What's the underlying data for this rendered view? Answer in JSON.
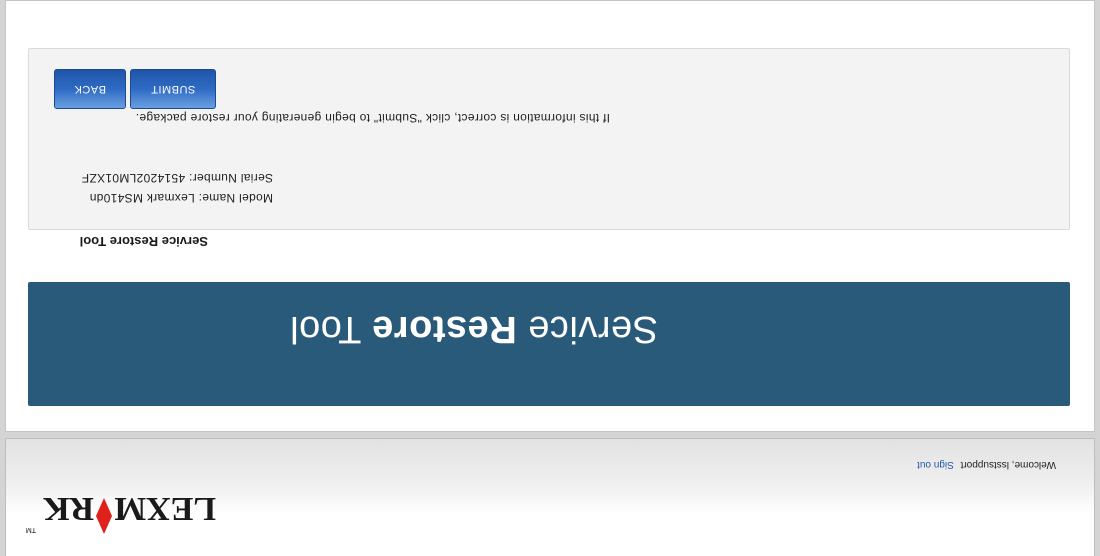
{
  "header": {
    "logo_text": "LEXMARK",
    "welcome_text": "Welcome, lsstsupport",
    "sign_out_label": "Sign out"
  },
  "banner": {
    "title_light_1": "Service",
    "title_bold": "Restore",
    "title_light_2": "Tool"
  },
  "section_heading": "Service Restore Tool",
  "device_info": {
    "model_label": "Model Name:",
    "model_value": "Lexmark MS410dn",
    "serial_label": "Serial Number:",
    "serial_value": "4514202LM01XZF"
  },
  "instruction": "If this information is correct, click \"Submit\" to begin generating your restore package.",
  "buttons": {
    "back_label": "BACK",
    "submit_label": "SUBMIT"
  },
  "colors": {
    "banner_bg": "#2a5a7a",
    "button_blue": "#2f6bc4",
    "logo_diamond": "#e0201a",
    "link_blue": "#1f5aa6"
  }
}
